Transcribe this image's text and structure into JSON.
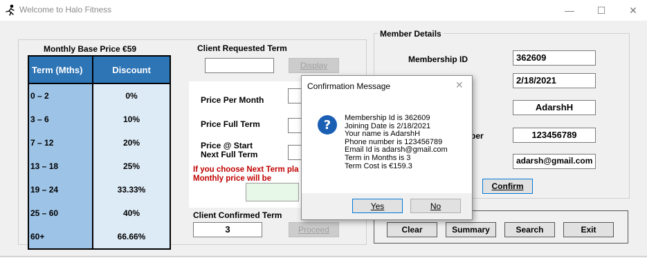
{
  "window": {
    "title": "Welcome to Halo Fitness",
    "controls": {
      "minimize": "—",
      "maximize": "☐",
      "close": "✕"
    }
  },
  "pricing": {
    "title": "Monthly Base Price €59",
    "headers": [
      "Term (Mths)",
      "Discount"
    ],
    "rows": [
      {
        "term": "0 – 2",
        "discount": "0%"
      },
      {
        "term": "3 – 6",
        "discount": "10%"
      },
      {
        "term": "7 – 12",
        "discount": "20%"
      },
      {
        "term": "13 – 18",
        "discount": "25%"
      },
      {
        "term": "19 – 24",
        "discount": "33.33%"
      },
      {
        "term": "25 – 60",
        "discount": "40%"
      },
      {
        "term": "60+",
        "discount": "66.66%"
      }
    ]
  },
  "middle": {
    "requested_label": "Client Requested Term",
    "requested_value": "",
    "display_button": "Display",
    "price_per_month": "Price Per Month",
    "price_full_term": "Price Full Term",
    "price_start_1": "Price @ Start",
    "price_start_2": "Next Full Term",
    "next_term_1": "If you choose Next Term pla",
    "next_term_2": "Monthly price will be",
    "confirmed_label": "Client Confirmed Term",
    "confirmed_value": "3",
    "proceed_button": "Proceed"
  },
  "member": {
    "group_title": "Member Details",
    "membership_id_label": "Membership ID",
    "membership_id": "362609",
    "join_date": "2/18/2021",
    "name": "AdarshH",
    "phone_label_fragment": "ber",
    "phone": "123456789",
    "email": "adarsh@gmail.com",
    "confirm_button": "Confirm"
  },
  "actions": {
    "clear": "Clear",
    "summary": "Summary",
    "search": "Search",
    "exit": "Exit"
  },
  "dialog": {
    "title": "Confirmation Message",
    "icon": "question-icon",
    "lines": [
      "Membership Id is 362609",
      "Joining Date is 2/18/2021",
      "Your name is AdarshH",
      "Phone number is 123456789",
      "Email Id is adarsh@gmail.com",
      "Term in Months is 3",
      "Term Cost is €159.3"
    ],
    "yes": "Yes",
    "no": "No"
  },
  "colors": {
    "header_blue": "#2e75b6",
    "term_col": "#9dc3e6",
    "discount_col": "#ddebf7",
    "warning_red": "#c00000",
    "question_icon": "#1a5fb4"
  }
}
